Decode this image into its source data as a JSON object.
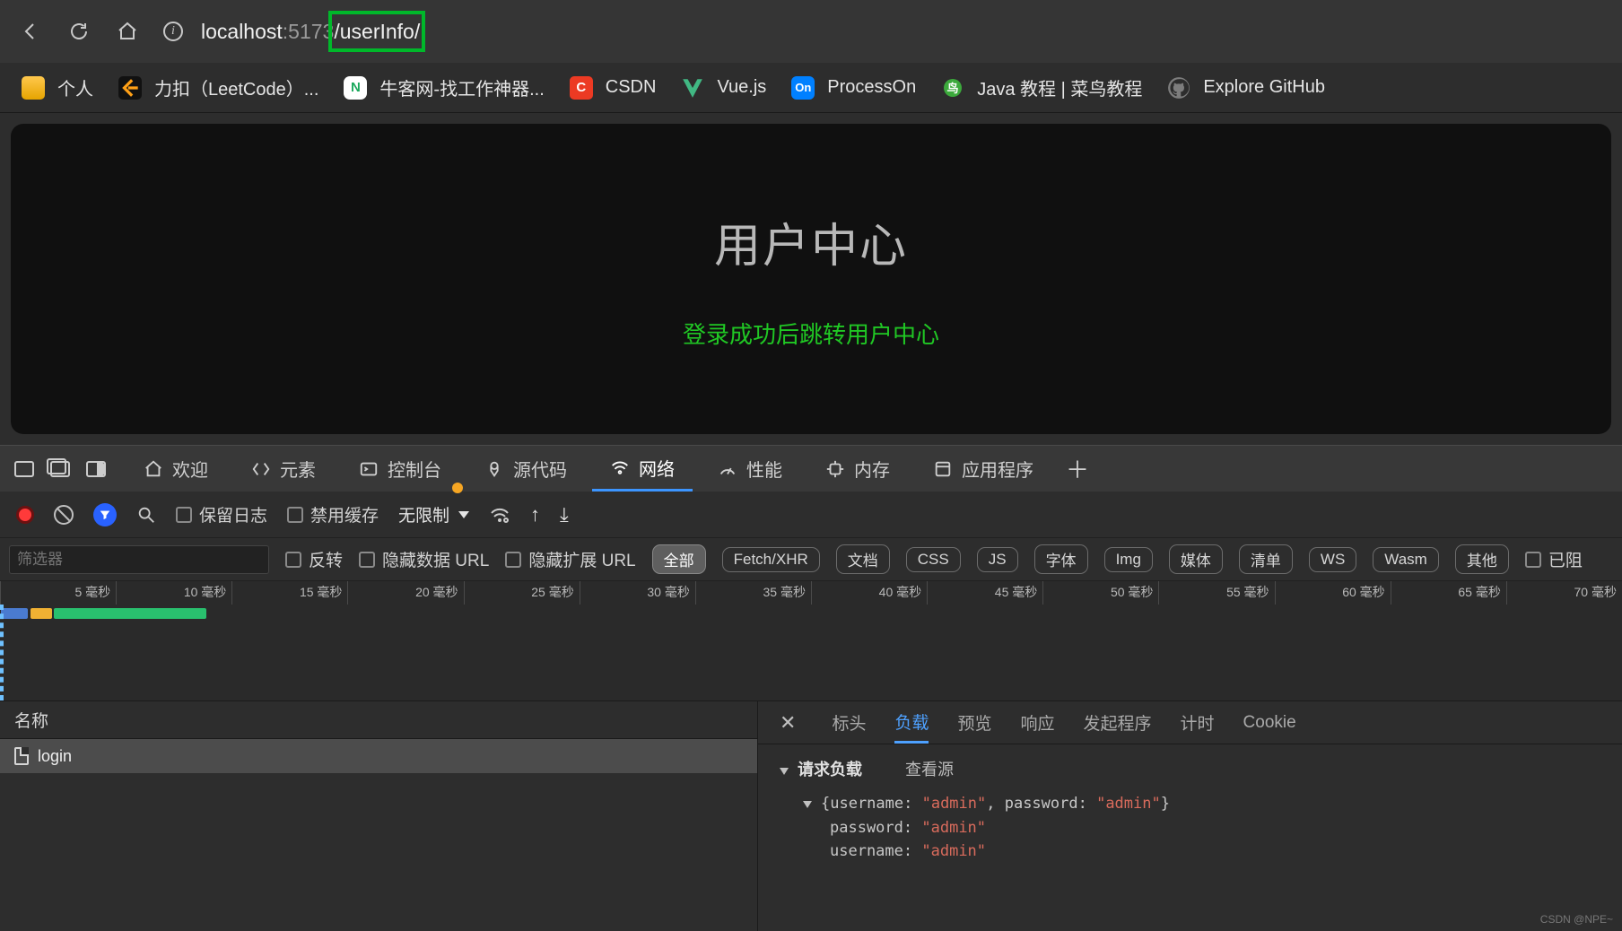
{
  "browser": {
    "url_host": "localhost",
    "url_port": ":5173",
    "url_path": "/userInfo/"
  },
  "bookmarks": [
    {
      "icon": "folder",
      "label": "个人"
    },
    {
      "icon": "leetcode",
      "label": "力扣（LeetCode）..."
    },
    {
      "icon": "nowcoder",
      "label": "牛客网-找工作神器..."
    },
    {
      "icon": "csdn",
      "label": "CSDN",
      "badge": "C"
    },
    {
      "icon": "vue",
      "label": "Vue.js"
    },
    {
      "icon": "processon",
      "label": "ProcessOn",
      "badge": "On"
    },
    {
      "icon": "java",
      "label": "Java 教程 | 菜鸟教程"
    },
    {
      "icon": "github",
      "label": "Explore GitHub"
    }
  ],
  "page": {
    "title": "用户中心",
    "subtitle": "登录成功后跳转用户中心"
  },
  "devtools": {
    "tabs": [
      "欢迎",
      "元素",
      "控制台",
      "源代码",
      "网络",
      "性能",
      "内存",
      "应用程序"
    ],
    "tabs_active": 4,
    "toolbar": {
      "preserve_log": "保留日志",
      "disable_cache": "禁用缓存",
      "throttle": "无限制"
    },
    "filter_placeholder": "筛选器",
    "filter_checks": [
      "反转",
      "隐藏数据 URL",
      "隐藏扩展 URL"
    ],
    "filter_types": [
      "全部",
      "Fetch/XHR",
      "文档",
      "CSS",
      "JS",
      "字体",
      "Img",
      "媒体",
      "清单",
      "WS",
      "Wasm",
      "其他"
    ],
    "filter_types_active": 0,
    "blocked": "已阻",
    "timeline_ticks": [
      "5 毫秒",
      "10 毫秒",
      "15 毫秒",
      "20 毫秒",
      "25 毫秒",
      "30 毫秒",
      "35 毫秒",
      "40 毫秒",
      "45 毫秒",
      "50 毫秒",
      "55 毫秒",
      "60 毫秒",
      "65 毫秒",
      "70 毫秒"
    ],
    "netlist_header": "名称",
    "netlist_rows": [
      {
        "name": "login"
      }
    ],
    "detail_tabs": [
      "标头",
      "负载",
      "预览",
      "响应",
      "发起程序",
      "计时",
      "Cookie"
    ],
    "detail_tabs_active": 1,
    "detail": {
      "section_title": "请求负载",
      "view_source": "查看源",
      "summary_prefix": "{username: ",
      "summary_v1": "\"admin\"",
      "summary_mid": ", password: ",
      "summary_v2": "\"admin\"",
      "summary_suffix": "}",
      "payload": [
        {
          "k": "password:",
          "v": "\"admin\""
        },
        {
          "k": "username:",
          "v": "\"admin\""
        }
      ]
    }
  },
  "watermark": "CSDN @NPE~"
}
